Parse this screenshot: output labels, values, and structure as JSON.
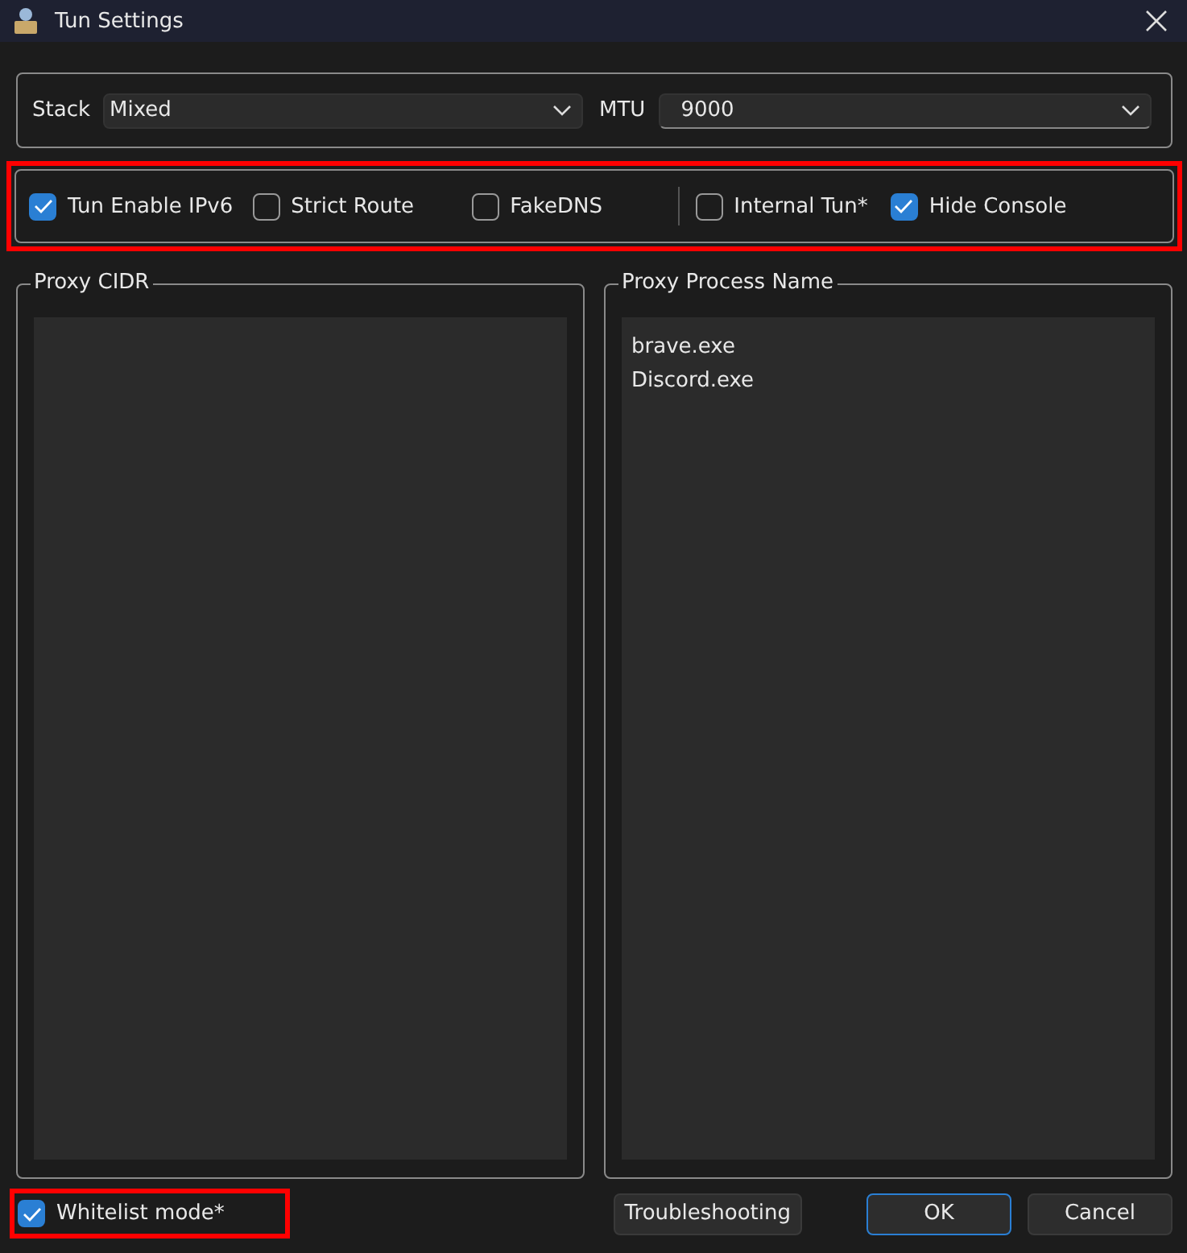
{
  "window": {
    "title": "Tun Settings"
  },
  "stack": {
    "label": "Stack",
    "value": "Mixed"
  },
  "mtu": {
    "label": "MTU",
    "value": "9000"
  },
  "options": [
    {
      "label": "Tun Enable IPv6",
      "checked": true
    },
    {
      "label": "Strict Route",
      "checked": false
    },
    {
      "label": "FakeDNS",
      "checked": false
    },
    {
      "label": "Internal Tun*",
      "checked": false
    },
    {
      "label": "Hide Console",
      "checked": true
    }
  ],
  "proxy_cidr": {
    "title": "Proxy CIDR"
  },
  "proxy_process": {
    "title": "Proxy Process Name",
    "lines": [
      "brave.exe",
      "Discord.exe"
    ]
  },
  "whitelist": {
    "label": "Whitelist mode*",
    "checked": true
  },
  "buttons": [
    {
      "label": "Troubleshooting",
      "kind": "plain"
    },
    {
      "label": "OK",
      "kind": "default"
    },
    {
      "label": "Cancel",
      "kind": "plain"
    }
  ]
}
